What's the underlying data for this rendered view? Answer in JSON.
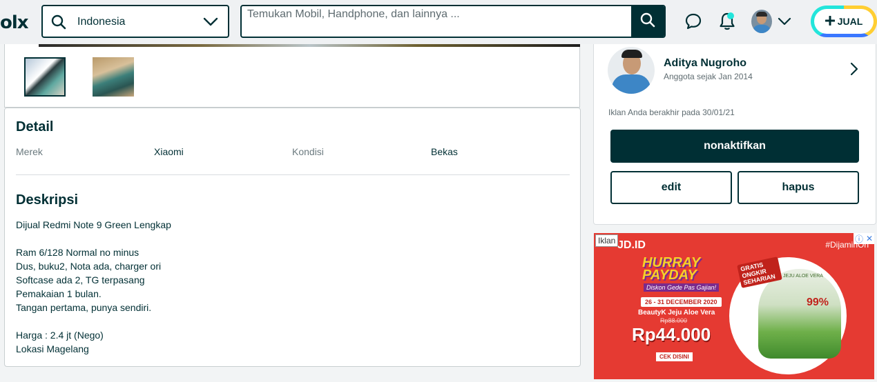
{
  "header": {
    "logo_text": "olx",
    "location_value": "Indonesia",
    "search_placeholder": "Temukan Mobil, Handphone, dan lainnya ...",
    "sell_label": "JUAL"
  },
  "detail": {
    "title": "Detail",
    "fields": [
      {
        "label": "Merek",
        "value": "Xiaomi"
      },
      {
        "label": "Kondisi",
        "value": "Bekas"
      }
    ]
  },
  "description": {
    "title": "Deskripsi",
    "lines": [
      "Dijual Redmi Note 9 Green Lengkap",
      "",
      "Ram 6/128 Normal no minus",
      "Dus, buku2, Nota ada, charger ori",
      "Softcase ada 2, TG terpasang",
      "Pemakaian 1 bulan.",
      "Tangan pertama, punya sendiri.",
      "",
      "Harga : 2.4 jt (Nego)",
      "Lokasi Magelang"
    ]
  },
  "seller": {
    "name": "Aditya Nugroho",
    "member_since": "Anggota sejak Jan 2014",
    "expire_text": "Iklan Anda berakhir pada 30/01/21",
    "deactivate_label": "nonaktifkan",
    "edit_label": "edit",
    "delete_label": "hapus"
  },
  "ad": {
    "tag": "Iklan",
    "brand": "JD.ID",
    "hashtag": "#DijaminOri",
    "headline": "HURRAY PAYDAY",
    "subline": "Diskon Gede Pas Gajian!",
    "date": "26 - 31 DECEMBER 2020",
    "product": "BeautyK Jeju Aloe Vera",
    "old_price": "Rp88.000",
    "price": "Rp44.000",
    "cta": "CEK DISINI",
    "badge": "GRATIS ONGKIR SEHARIAN",
    "can_label": "JEJU ALOE VERA",
    "percent": "99%"
  },
  "colors": {
    "brand_dark": "#002f34",
    "accent_teal": "#23e5db",
    "accent_yellow": "#ffce32",
    "accent_blue": "#3a77ff",
    "ad_red": "#e53a32"
  }
}
